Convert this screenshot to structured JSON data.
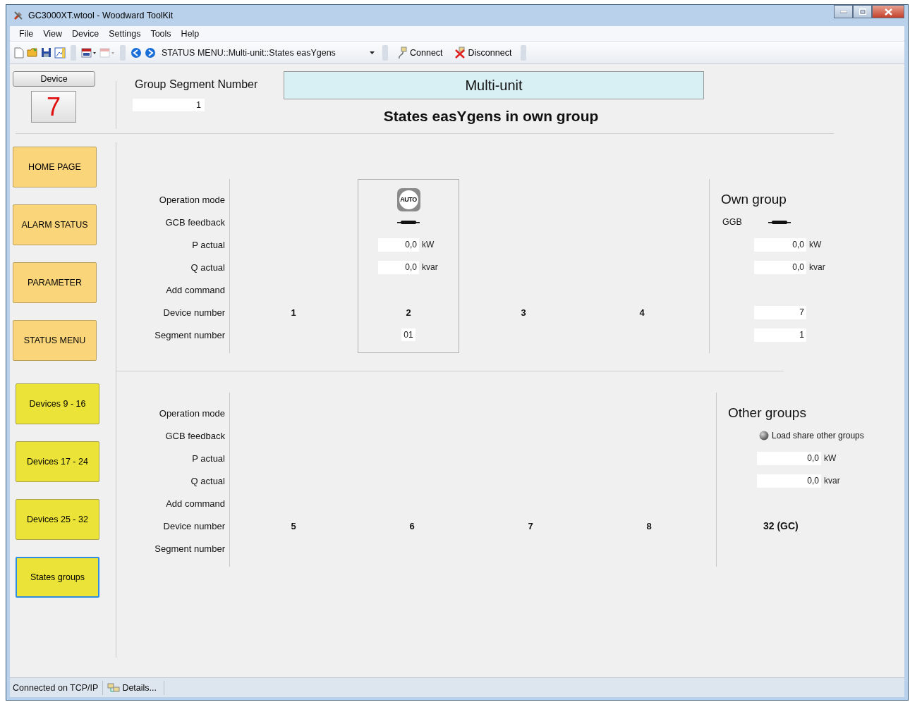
{
  "window": {
    "title": "GC3000XT.wtool - Woodward ToolKit"
  },
  "menu": [
    "File",
    "View",
    "Device",
    "Settings",
    "Tools",
    "Help"
  ],
  "toolbar": {
    "address": "STATUS MENU::Multi-unit::States easYgens",
    "connect": "Connect",
    "disconnect": "Disconnect"
  },
  "device": {
    "label": "Device",
    "number": "7"
  },
  "group_segment": {
    "label": "Group Segment Number",
    "value": "1"
  },
  "header": {
    "title": "Multi-unit",
    "subtitle": "States easYgens in own group"
  },
  "nav": [
    {
      "label": "HOME PAGE",
      "kind": "orange",
      "selected": false
    },
    {
      "label": "ALARM STATUS",
      "kind": "orange",
      "selected": false
    },
    {
      "label": "PARAMETER",
      "kind": "orange",
      "selected": false
    },
    {
      "label": "STATUS MENU",
      "kind": "orange",
      "selected": false
    },
    {
      "label": "Devices 9 - 16",
      "kind": "yellow",
      "selected": false
    },
    {
      "label": "Devices 17 - 24",
      "kind": "yellow",
      "selected": false
    },
    {
      "label": "Devices 25 - 32",
      "kind": "yellow",
      "selected": false
    },
    {
      "label": "States groups",
      "kind": "yellow",
      "selected": true
    }
  ],
  "blocks": [
    {
      "row_labels": [
        "Operation mode",
        "GCB feedback",
        "P actual",
        "Q actual",
        "Add command",
        "Device number",
        "Segment number"
      ],
      "devices": [
        {
          "number": "1",
          "present": false
        },
        {
          "number": "2",
          "present": true,
          "mode": "AUTO",
          "gcb_closed": true,
          "p": "0,0",
          "p_unit": "kW",
          "q": "0,0",
          "q_unit": "kvar",
          "segment": "01"
        },
        {
          "number": "3",
          "present": false
        },
        {
          "number": "4",
          "present": false
        }
      ],
      "side": [
        {
          "kind": "title",
          "text": "Own group"
        },
        {
          "kind": "breaker",
          "label": "GGB",
          "closed": true
        },
        {
          "kind": "power",
          "value": "0,0",
          "unit": "kW"
        },
        {
          "kind": "power",
          "value": "0,0",
          "unit": "kvar"
        },
        {
          "kind": "device",
          "value": "7"
        },
        {
          "kind": "device",
          "value": "1"
        }
      ]
    },
    {
      "row_labels": [
        "Operation mode",
        "GCB feedback",
        "P actual",
        "Q actual",
        "Add command",
        "Device number",
        "Segment number"
      ],
      "devices": [
        {
          "number": "5",
          "present": false
        },
        {
          "number": "6",
          "present": false
        },
        {
          "number": "7",
          "present": false
        },
        {
          "number": "8",
          "present": false
        }
      ],
      "side": [
        {
          "kind": "title",
          "text": "Other groups"
        },
        {
          "kind": "led",
          "label": "Load share other groups",
          "on": false
        },
        {
          "kind": "power",
          "value": "0,0",
          "unit": "kW"
        },
        {
          "kind": "power",
          "value": "0,0",
          "unit": "kvar"
        },
        {
          "kind": "device_label",
          "value": "32 (GC)"
        }
      ]
    }
  ],
  "status_bar": {
    "connection": "Connected on TCP/IP",
    "details": "Details..."
  }
}
